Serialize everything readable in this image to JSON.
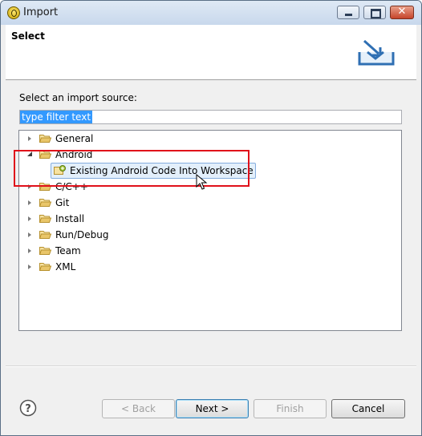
{
  "window": {
    "title": "Import"
  },
  "header": {
    "title": "Select"
  },
  "body": {
    "prompt": "Select an import source:",
    "filter_value": "type filter text",
    "tree": [
      {
        "label": "General",
        "expanded": false
      },
      {
        "label": "Android",
        "expanded": true,
        "children": [
          {
            "label": "Existing Android Code Into Workspace",
            "selected": true
          }
        ]
      },
      {
        "label": "C/C++",
        "expanded": false
      },
      {
        "label": "Git",
        "expanded": false
      },
      {
        "label": "Install",
        "expanded": false
      },
      {
        "label": "Run/Debug",
        "expanded": false
      },
      {
        "label": "Team",
        "expanded": false
      },
      {
        "label": "XML",
        "expanded": false
      }
    ]
  },
  "buttons": {
    "back": "< Back",
    "next": "Next >",
    "finish": "Finish",
    "cancel": "Cancel"
  },
  "colors": {
    "highlight_box": "#e0101a",
    "selection": "#3399ff",
    "folder": "#e9c66a"
  },
  "icons": {
    "app": "eclipse-icon",
    "header": "import-tray-icon",
    "help": "help-icon",
    "folder": "folder-icon",
    "project": "android-project-icon",
    "cursor": "mouse-pointer-icon"
  }
}
